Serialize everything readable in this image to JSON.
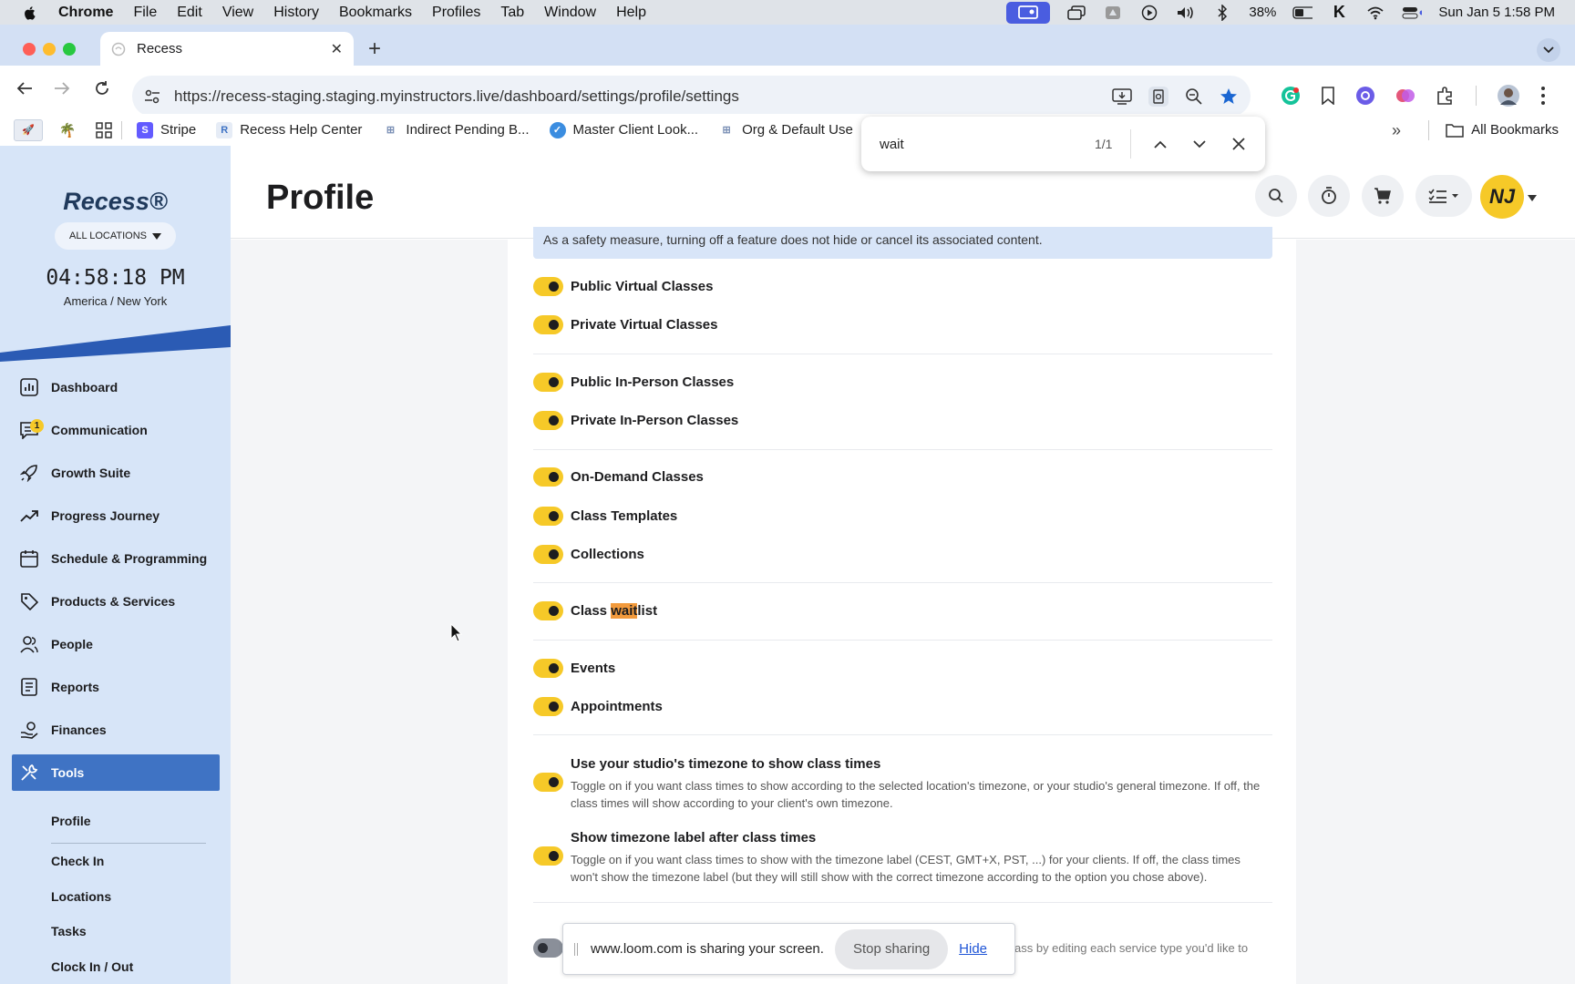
{
  "menubar": {
    "app": "Chrome",
    "items": [
      "File",
      "Edit",
      "View",
      "History",
      "Bookmarks",
      "Profiles",
      "Tab",
      "Window",
      "Help"
    ],
    "battery": "38%",
    "datetime": "Sun Jan 5  1:58 PM"
  },
  "browser": {
    "tab_title": "Recess",
    "url": "https://recess-staging.staging.myinstructors.live/dashboard/settings/profile/settings",
    "bookmarks": [
      "Stripe",
      "Recess Help Center",
      "Indirect Pending B...",
      "Master Client Look...",
      "Org & Default Use"
    ],
    "all_bookmarks": "All Bookmarks"
  },
  "findbar": {
    "query": "wait",
    "count": "1/1"
  },
  "sidebar": {
    "brand": "Recess®",
    "location_selector": "ALL LOCATIONS",
    "clock": "04:58:18 PM",
    "timezone": "America / New York",
    "nav": [
      {
        "label": "Dashboard",
        "icon": "bar-chart-icon"
      },
      {
        "label": "Communication",
        "icon": "message-icon",
        "badge": "1"
      },
      {
        "label": "Growth Suite",
        "icon": "rocket-icon"
      },
      {
        "label": "Progress Journey",
        "icon": "trending-up-icon"
      },
      {
        "label": "Schedule & Programming",
        "icon": "calendar-icon"
      },
      {
        "label": "Products & Services",
        "icon": "tag-icon"
      },
      {
        "label": "People",
        "icon": "people-icon"
      },
      {
        "label": "Reports",
        "icon": "report-icon"
      },
      {
        "label": "Finances",
        "icon": "hand-coin-icon"
      },
      {
        "label": "Tools",
        "icon": "tools-icon",
        "active": true
      }
    ],
    "sub_items": [
      "Profile",
      "Check In",
      "Locations",
      "Tasks",
      "Clock In / Out"
    ]
  },
  "header": {
    "title": "Profile",
    "avatar_initials": "NJ"
  },
  "content": {
    "notice": "As a safety measure, turning off a feature does not hide or cancel its associated content.",
    "toggles": [
      {
        "label": "Public Virtual Classes",
        "on": true
      },
      {
        "label": "Private Virtual Classes",
        "on": true
      },
      {
        "label": "Public In-Person Classes",
        "on": true
      },
      {
        "label": "Private In-Person Classes",
        "on": true
      },
      {
        "label": "On-Demand Classes",
        "on": true
      },
      {
        "label": "Class Templates",
        "on": true
      },
      {
        "label": "Collections",
        "on": true
      },
      {
        "label_pre": "Class ",
        "label_highlight": "wait",
        "label_post": "list",
        "on": true
      },
      {
        "label": "Events",
        "on": true
      },
      {
        "label": "Appointments",
        "on": true
      },
      {
        "label": "Use your studio's timezone to show class times",
        "on": true,
        "description": "Toggle on if you want class times to show according to the selected location's timezone, or your studio's general timezone. If off, the class times will show according to your client's own timezone."
      },
      {
        "label": "Show timezone label after class times",
        "on": true,
        "description": "Toggle on if you want class times to show with the timezone label (CEST, GMT+X, PST, ...) for your clients. If off, the class times won't show the timezone label (but they will still show with the correct timezone according to the option you chose above)."
      },
      {
        "label": "",
        "on": false
      }
    ],
    "partial_text": "ass by editing each service type you'd like to"
  },
  "share_banner": {
    "message": "www.loom.com is sharing your screen.",
    "stop_label": "Stop sharing",
    "hide_label": "Hide"
  },
  "colors": {
    "accent": "#f6c928",
    "sidebar_bg": "#d7e5f8",
    "nav_active": "#3f73c4",
    "highlight": "#f29a3c",
    "brand_stripe": "#2b5bb4"
  }
}
